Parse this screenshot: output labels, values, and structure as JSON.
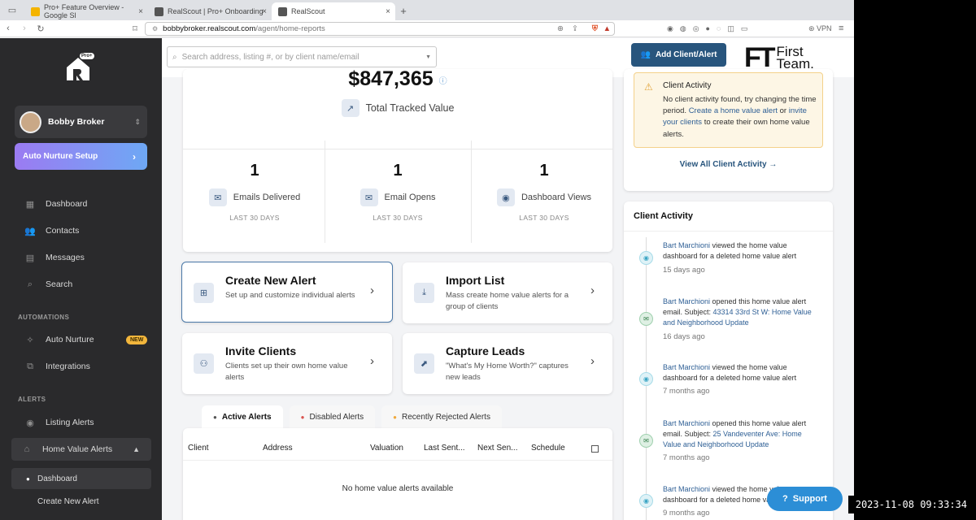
{
  "browser": {
    "tabs": [
      {
        "label": "Pro+ Feature Overview - Google Sl",
        "favicon_color": "#f4b400"
      },
      {
        "label": "RealScout | Pro+ Onboarding",
        "favicon_color": "#555555"
      },
      {
        "label": "RealScout",
        "favicon_color": "#555555"
      }
    ],
    "active_tab_index": 2,
    "url_host": "bobbybroker.realscout.com",
    "url_path": "/agent/home-reports",
    "vpn_label": "VPN"
  },
  "sidebar": {
    "logo_badge": "Pro+",
    "user_name": "Bobby Broker",
    "nurture_button": "Auto Nurture Setup",
    "main_items": [
      "Dashboard",
      "Contacts",
      "Messages",
      "Search"
    ],
    "automations_title": "AUTOMATIONS",
    "automation_items": [
      "Auto Nurture",
      "Integrations"
    ],
    "new_badge": "NEW",
    "alerts_title": "ALERTS",
    "alert_items": [
      "Listing Alerts",
      "Home Value Alerts"
    ],
    "sub_items": [
      "Dashboard",
      "Create New Alert"
    ]
  },
  "topbar": {
    "search_placeholder": "Search address, listing #, or by client name/email",
    "add_button": "Add Client/Alert",
    "brand_mark": "FT",
    "brand_line1": "First",
    "brand_line2": "Team."
  },
  "summary": {
    "total_value": "$847,365",
    "total_label": "Total Tracked Value",
    "stats": [
      {
        "value": "1",
        "label": "Emails Delivered",
        "period": "LAST 30 DAYS"
      },
      {
        "value": "1",
        "label": "Email Opens",
        "period": "LAST 30 DAYS"
      },
      {
        "value": "1",
        "label": "Dashboard Views",
        "period": "LAST 30 DAYS"
      }
    ]
  },
  "actions": [
    {
      "title": "Create New Alert",
      "desc": "Set up and customize individual alerts"
    },
    {
      "title": "Import List",
      "desc": "Mass create home value alerts for a group of clients"
    },
    {
      "title": "Invite Clients",
      "desc": "Clients set up their own home value alerts"
    },
    {
      "title": "Capture Leads",
      "desc": "\"What's My Home Worth?\" captures new leads"
    }
  ],
  "alert_tabs": [
    {
      "label": "Active Alerts",
      "color": "#555555"
    },
    {
      "label": "Disabled Alerts",
      "color": "#d9534f"
    },
    {
      "label": "Recently Rejected Alerts",
      "color": "#f0a93b"
    }
  ],
  "table": {
    "columns": [
      "Client",
      "Address",
      "Valuation",
      "Last Sent...",
      "Next Sen...",
      "Schedule"
    ],
    "empty_message": "No home value alerts available"
  },
  "client_activity_alert": {
    "title": "Client Activity",
    "text_before": "No client activity found, try changing the time period. ",
    "link1": "Create a home value alert",
    "text_mid": " or ",
    "link2": "invite your clients",
    "text_after": " to create their own home value alerts.",
    "view_all": "View All Client Activity"
  },
  "client_activity": {
    "title": "Client Activity",
    "events": [
      {
        "type": "view",
        "actor": "Bart Marchioni",
        "text": " viewed the home value dashboard for a deleted home value alert",
        "subject": "",
        "time": "15 days ago"
      },
      {
        "type": "mail",
        "actor": "Bart Marchioni",
        "text": " opened this home value alert email. Subject: ",
        "subject": "43314 33rd St W: Home Value and Neighborhood Update",
        "time": "16 days ago"
      },
      {
        "type": "view",
        "actor": "Bart Marchioni",
        "text": " viewed the home value dashboard for a deleted home value alert",
        "subject": "",
        "time": "7 months ago"
      },
      {
        "type": "mail",
        "actor": "Bart Marchioni",
        "text": " opened this home value alert email. Subject: ",
        "subject": "25 Vandeventer Ave: Home Value and Neighborhood Update",
        "time": "7 months ago"
      },
      {
        "type": "view",
        "actor": "Bart Marchioni",
        "text": " viewed the home value dashboard for a deleted home value alert",
        "subject": "",
        "time": "9 months ago"
      }
    ]
  },
  "support_button": "Support",
  "timestamp": "2023-11-08 09:33:34",
  "colors": {
    "primary": "#28557d",
    "sidebar": "#2a2a2c",
    "accent_gradient_start": "#9b7bf2",
    "accent_gradient_end": "#6ea8f4"
  }
}
